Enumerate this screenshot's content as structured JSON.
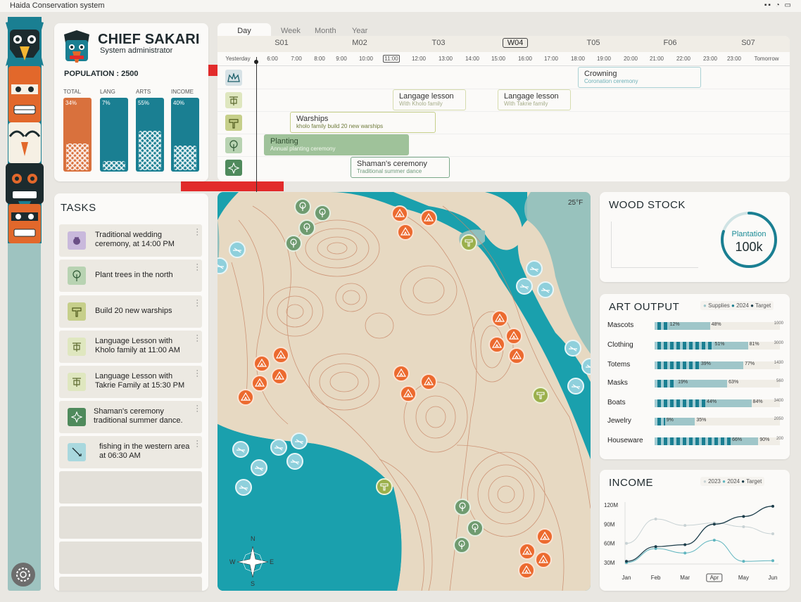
{
  "window": {
    "title": "Haida Conservation system"
  },
  "profile": {
    "name": "CHIEF SAKARI",
    "role": "System administrator",
    "population": "POPULATION : 2500",
    "stats": [
      {
        "label": "TOTAL",
        "value": "34%",
        "color": "#d9713d"
      },
      {
        "label": "LANG",
        "value": "7%",
        "color": "#1a7f92"
      },
      {
        "label": "ARTS",
        "value": "55%",
        "color": "#1a7f92"
      },
      {
        "label": "INCOME",
        "value": "40%",
        "color": "#1a7f92"
      }
    ]
  },
  "timeline": {
    "tabs": [
      "Day",
      "Week",
      "Month",
      "Year"
    ],
    "weeks": [
      "S01",
      "M02",
      "T03",
      "W04",
      "T05",
      "F06",
      "S07"
    ],
    "hours": [
      "Yesterday",
      "6:00",
      "7:00",
      "8:00",
      "9:00",
      "10:00",
      "11:00",
      "12:00",
      "13:00",
      "14:00",
      "15:00",
      "16:00",
      "17:00",
      "18:00",
      "19:00",
      "20:00",
      "21:00",
      "22:00",
      "23:00",
      "23:00",
      "Tomorrow"
    ],
    "events": [
      {
        "title": "Crowning",
        "sub": "Coronation ceremony"
      },
      {
        "title": "Langage lesson",
        "sub": "With Kholo family"
      },
      {
        "title": "Langage lesson",
        "sub": "With Takrie family"
      },
      {
        "title": "Warships",
        "sub": "kholo family build 20 new warships"
      },
      {
        "title": "Planting",
        "sub": "Annual planting ceremony"
      },
      {
        "title": "Shaman's ceremony",
        "sub": "Traditional summer dance"
      }
    ]
  },
  "tasks": {
    "title": "TASKS",
    "items": [
      {
        "text": "Traditional wedding ceremony, at 14:00 PM",
        "icon": "wedding-icon",
        "color": "#c9b9dc"
      },
      {
        "text": "Plant trees in the north",
        "icon": "tree-icon",
        "color": "#b8d3b2"
      },
      {
        "text": "Build 20 new warships",
        "icon": "warship-icon",
        "color": "#c6cf8a"
      },
      {
        "text": "Language Lesson with Kholo family at 11:00 AM",
        "icon": "language-icon",
        "color": "#dfe7bf"
      },
      {
        "text": "Language Lesson with Takrie Family at 15:30 PM",
        "icon": "language-icon",
        "color": "#dfe7bf"
      },
      {
        "text": "Shaman's ceremony traditional summer dance.",
        "icon": "shaman-icon",
        "color": "#4f8a5c"
      },
      {
        "text": "fishing in the western area at 06:30 AM",
        "icon": "fishing-icon",
        "color": "#a9d8de"
      }
    ]
  },
  "map": {
    "temperature": "25°F",
    "compass": [
      "N",
      "E",
      "S",
      "W"
    ]
  },
  "wood": {
    "title": "WOOD STOCK",
    "label": "Plantation",
    "value": "100k",
    "level": 0.8
  },
  "art": {
    "title": "ART OUTPUT",
    "legend": [
      "Supplies",
      "2024",
      "Target"
    ],
    "rows": [
      {
        "label": "Mascots",
        "supplies": "12%",
        "y2024": "48%",
        "target": "1000",
        "s": 12,
        "y": 48
      },
      {
        "label": "Clothing",
        "supplies": "51%",
        "y2024": "81%",
        "target": "3000",
        "s": 51,
        "y": 81
      },
      {
        "label": "Totems",
        "supplies": "39%",
        "y2024": "77%",
        "target": "1430",
        "s": 39,
        "y": 77
      },
      {
        "label": "Masks",
        "supplies": "19%",
        "y2024": "63%",
        "target": "560",
        "s": 19,
        "y": 63
      },
      {
        "label": "Boats",
        "supplies": "44%",
        "y2024": "84%",
        "target": "3400",
        "s": 44,
        "y": 84
      },
      {
        "label": "Jewelry",
        "supplies": "9%",
        "y2024": "35%",
        "target": "2050",
        "s": 9,
        "y": 35
      },
      {
        "label": "Houseware",
        "supplies": "66%",
        "y2024": "90%",
        "target": "200",
        "s": 66,
        "y": 90
      }
    ]
  },
  "income": {
    "title": "INCOME",
    "legend": [
      "2023",
      "2024",
      "Target"
    ],
    "chart_data": {
      "type": "line",
      "categories": [
        "Jan",
        "Feb",
        "Mar",
        "Apr",
        "May",
        "Jun"
      ],
      "ylim": [
        30,
        120
      ],
      "yticks": [
        "120M",
        "90M",
        "60M",
        "30M"
      ],
      "series": [
        {
          "name": "2023",
          "values": [
            60,
            98,
            88,
            92,
            86,
            75
          ]
        },
        {
          "name": "2024",
          "values": [
            30,
            52,
            45,
            65,
            32,
            33
          ]
        },
        {
          "name": "Target",
          "values": [
            32,
            55,
            58,
            90,
            102,
            118
          ]
        }
      ]
    }
  }
}
